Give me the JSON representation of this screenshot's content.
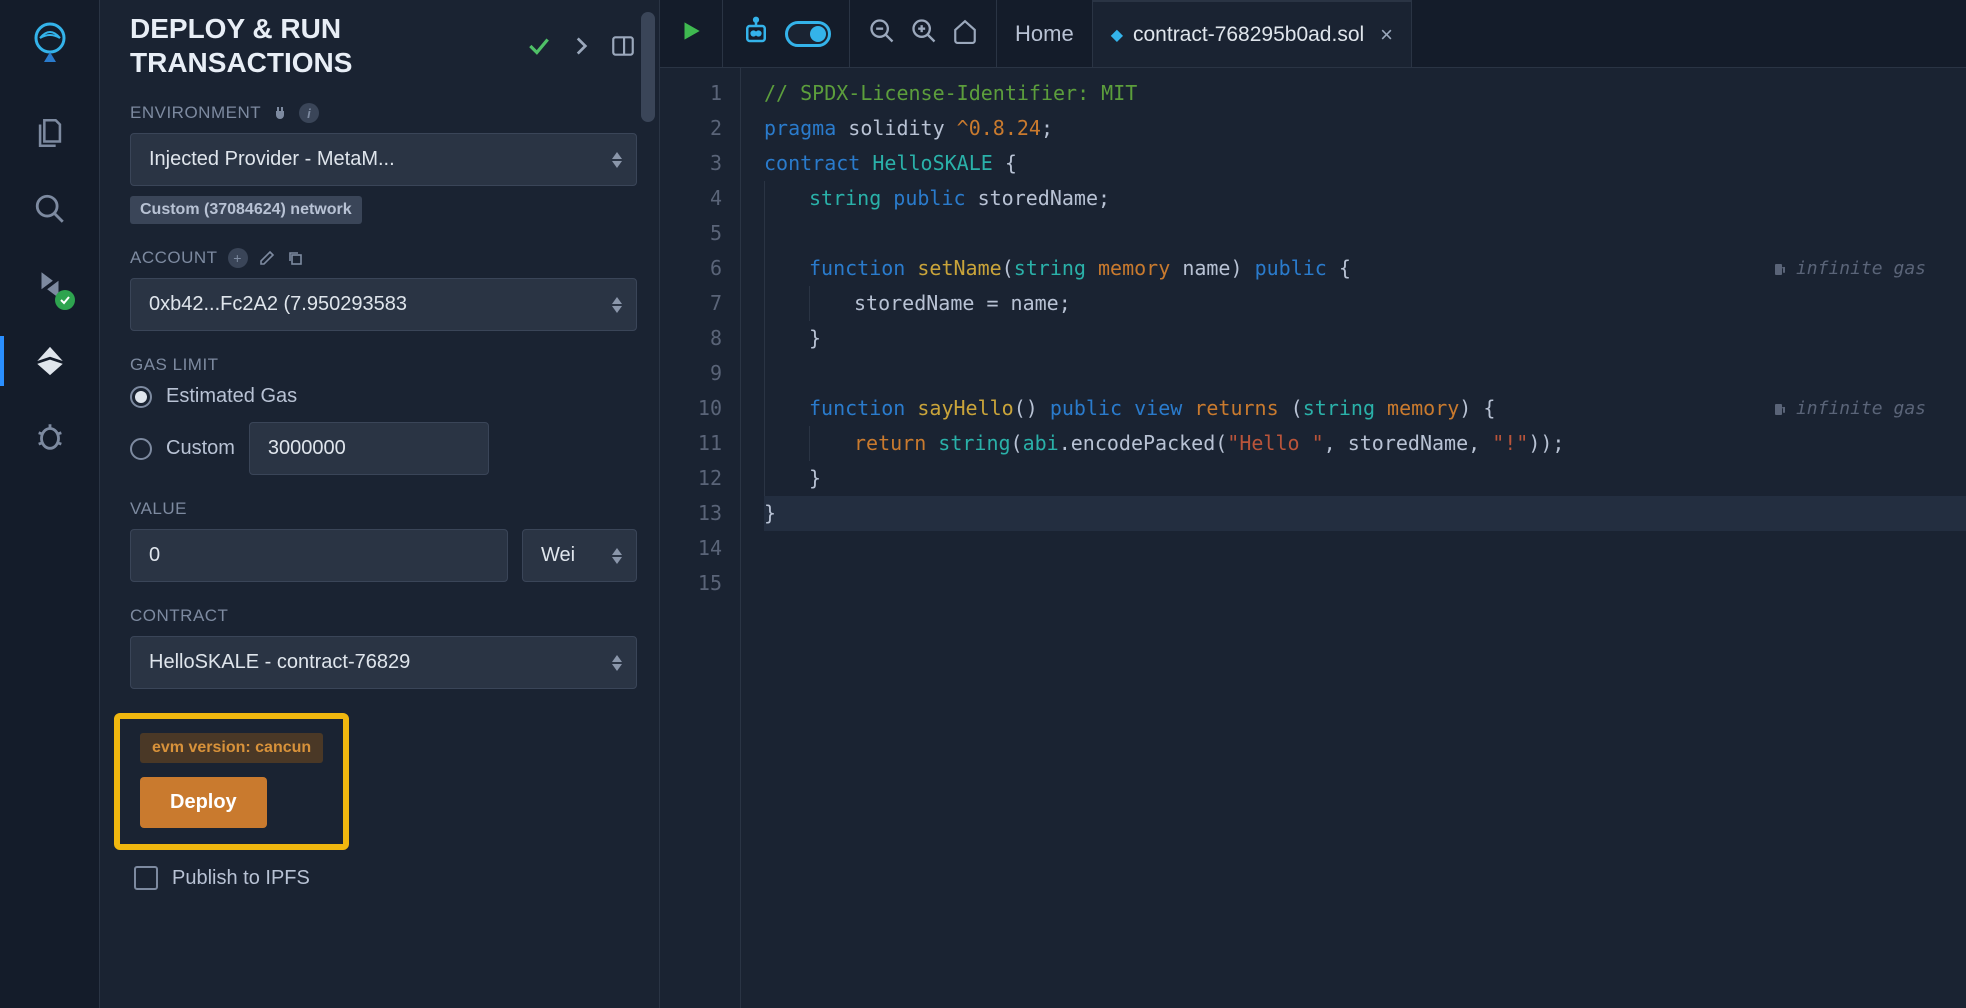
{
  "panel": {
    "title": "DEPLOY & RUN TRANSACTIONS",
    "environment": {
      "label": "ENVIRONMENT",
      "value": "Injected Provider - MetaM...",
      "network_badge": "Custom (37084624) network"
    },
    "account": {
      "label": "ACCOUNT",
      "value": "0xb42...Fc2A2 (7.950293583"
    },
    "gas_limit": {
      "label": "GAS LIMIT",
      "estimated_label": "Estimated Gas",
      "custom_label": "Custom",
      "custom_value": "3000000",
      "selected": "estimated"
    },
    "value": {
      "label": "VALUE",
      "amount": "0",
      "unit": "Wei"
    },
    "contract": {
      "label": "CONTRACT",
      "value": "HelloSKALE - contract-76829"
    },
    "evm_badge": "evm version: cancun",
    "deploy_label": "Deploy",
    "publish_label": "Publish to IPFS"
  },
  "editor": {
    "tabs": {
      "home": "Home",
      "file": "contract-768295b0ad.sol"
    },
    "gas_hint": "infinite gas",
    "code_lines": [
      {
        "n": 1,
        "tokens": [
          [
            "tk-comment",
            "// SPDX-License-Identifier: MIT"
          ]
        ]
      },
      {
        "n": 2,
        "tokens": [
          [
            "tk-keyword",
            "pragma"
          ],
          [
            "tk-punct",
            " "
          ],
          [
            "tk-ident",
            "solidity"
          ],
          [
            "tk-punct",
            " "
          ],
          [
            "tk-version",
            "^0.8.24"
          ],
          [
            "tk-punct",
            ";"
          ]
        ]
      },
      {
        "n": 3,
        "tokens": []
      },
      {
        "n": 4,
        "tokens": []
      },
      {
        "n": 5,
        "tokens": [
          [
            "tk-keyword",
            "contract"
          ],
          [
            "tk-punct",
            " "
          ],
          [
            "tk-type",
            "HelloSKALE"
          ],
          [
            "tk-punct",
            " {"
          ]
        ]
      },
      {
        "n": 6,
        "indent": 1,
        "tokens": [
          [
            "tk-type",
            "string"
          ],
          [
            "tk-punct",
            " "
          ],
          [
            "tk-keyword",
            "public"
          ],
          [
            "tk-punct",
            " "
          ],
          [
            "tk-ident",
            "storedName"
          ],
          [
            "tk-punct",
            ";"
          ]
        ]
      },
      {
        "n": 7,
        "indent": 1,
        "tokens": []
      },
      {
        "n": 8,
        "indent": 1,
        "gas": true,
        "tokens": [
          [
            "tk-keyword",
            "function"
          ],
          [
            "tk-punct",
            " "
          ],
          [
            "tk-fn",
            "setName"
          ],
          [
            "tk-punct",
            "("
          ],
          [
            "tk-type",
            "string"
          ],
          [
            "tk-punct",
            " "
          ],
          [
            "tk-param",
            "memory"
          ],
          [
            "tk-punct",
            " "
          ],
          [
            "tk-ident",
            "name"
          ],
          [
            "tk-punct",
            ") "
          ],
          [
            "tk-keyword",
            "public"
          ],
          [
            "tk-punct",
            " {"
          ]
        ]
      },
      {
        "n": 9,
        "indent": 2,
        "tokens": [
          [
            "tk-ident",
            "storedName"
          ],
          [
            "tk-punct",
            " = "
          ],
          [
            "tk-ident",
            "name"
          ],
          [
            "tk-punct",
            ";"
          ]
        ]
      },
      {
        "n": 10,
        "indent": 1,
        "tokens": [
          [
            "tk-punct",
            "}"
          ]
        ]
      },
      {
        "n": 11,
        "indent": 1,
        "tokens": []
      },
      {
        "n": 12,
        "indent": 1,
        "gas": true,
        "tokens": [
          [
            "tk-keyword",
            "function"
          ],
          [
            "tk-punct",
            " "
          ],
          [
            "tk-fn",
            "sayHello"
          ],
          [
            "tk-punct",
            "() "
          ],
          [
            "tk-keyword",
            "public"
          ],
          [
            "tk-punct",
            " "
          ],
          [
            "tk-keyword",
            "view"
          ],
          [
            "tk-punct",
            " "
          ],
          [
            "tk-param",
            "returns"
          ],
          [
            "tk-punct",
            " ("
          ],
          [
            "tk-type",
            "string"
          ],
          [
            "tk-punct",
            " "
          ],
          [
            "tk-param",
            "memory"
          ],
          [
            "tk-punct",
            ") {"
          ]
        ]
      },
      {
        "n": 13,
        "indent": 2,
        "tokens": [
          [
            "tk-param",
            "return"
          ],
          [
            "tk-punct",
            " "
          ],
          [
            "tk-type",
            "string"
          ],
          [
            "tk-punct",
            "("
          ],
          [
            "tk-type",
            "abi"
          ],
          [
            "tk-punct",
            ".encodePacked("
          ],
          [
            "tk-string",
            "\"Hello \""
          ],
          [
            "tk-punct",
            ", storedName, "
          ],
          [
            "tk-string",
            "\"!\""
          ],
          [
            "tk-punct",
            "));"
          ]
        ]
      },
      {
        "n": 14,
        "indent": 1,
        "tokens": [
          [
            "tk-punct",
            "}"
          ]
        ]
      },
      {
        "n": 15,
        "current": true,
        "tokens": [
          [
            "tk-punct",
            "}"
          ]
        ]
      }
    ]
  }
}
